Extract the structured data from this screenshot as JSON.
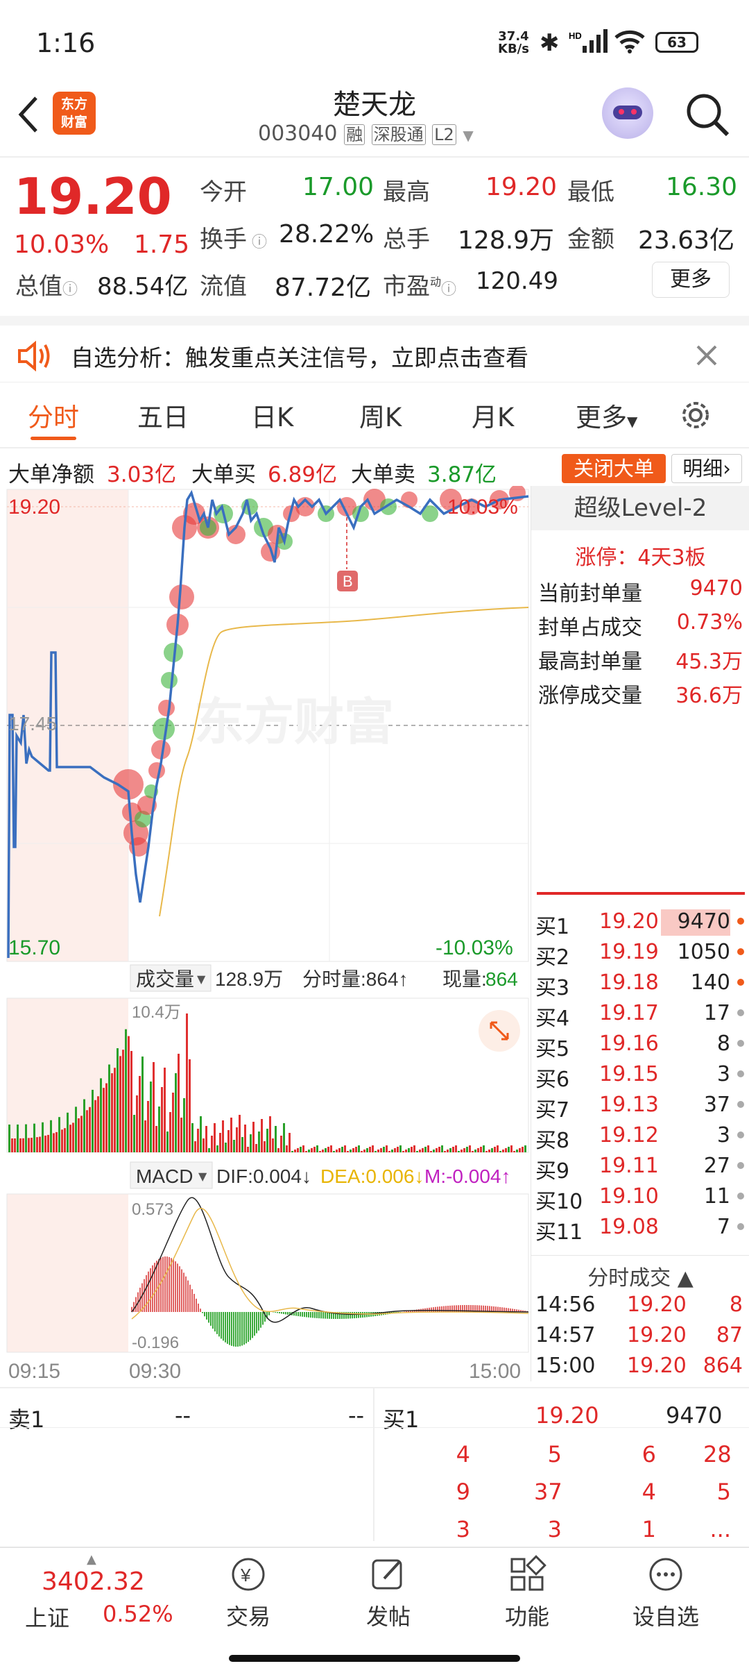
{
  "status": {
    "time": "1:16",
    "speed_top": "37.4",
    "speed_bottom": "KB/s",
    "battery": "63"
  },
  "header": {
    "app_logo_line1": "东方",
    "app_logo_line2": "财富",
    "name": "楚天龙",
    "code": "003040",
    "tag1": "融",
    "tag2": "深股通",
    "tag3": "L2"
  },
  "quote": {
    "price": "19.20",
    "pct": "10.03%",
    "chg": "1.75",
    "open_label": "今开",
    "open": "17.00",
    "high_label": "最高",
    "high": "19.20",
    "low_label": "最低",
    "low": "16.30",
    "turnover_label": "换手",
    "turnover": "28.22%",
    "vol_label": "总手",
    "vol": "128.9万",
    "amount_label": "金额",
    "amount": "23.63亿",
    "mcap_label": "总值",
    "mcap": "88.54亿",
    "float_label": "流值",
    "float": "87.72亿",
    "pe_label": "市盈",
    "pe_sup": "动",
    "pe": "120.49",
    "more": "更多"
  },
  "banner": {
    "text": "自选分析：触发重点关注信号，立即点击查看"
  },
  "tabs": [
    "分时",
    "五日",
    "日K",
    "周K",
    "月K",
    "更多"
  ],
  "bigorder": {
    "net_label": "大单净额",
    "net": "3.03亿",
    "buy_label": "大单买",
    "buy": "6.89亿",
    "sell_label": "大单卖",
    "sell": "3.87亿",
    "close_btn": "关闭大单",
    "detail_btn": "明细"
  },
  "chart": {
    "top_price": "19.20",
    "top_pct": "10.03%",
    "mid_price": "17.45",
    "bottom_price": "15.70",
    "bottom_pct": "-10.03%",
    "watermark": "东方财富",
    "marker": "B",
    "vol_label": "成交量",
    "vol_total": "128.9万",
    "vol_min_label": "分时量:864↑",
    "vol_now_label": "现量:",
    "vol_now": "864",
    "vol_max": "10.4万",
    "macd_label": "MACD",
    "dif": "DIF:0.004↓",
    "dea": "DEA:0.006↓",
    "m": "M:-0.004↑",
    "macd_max": "0.573",
    "macd_min": "-0.196",
    "t_start": "09:15",
    "t_open": "09:30",
    "t_end": "15:00"
  },
  "level2": {
    "title": "超级Level-2",
    "limit": "涨停：4天3板",
    "rows": [
      {
        "label": "当前封单量",
        "value": "9470"
      },
      {
        "label": "封单占成交",
        "value": "0.73%"
      },
      {
        "label": "最高封单量",
        "value": "45.3万"
      },
      {
        "label": "涨停成交量",
        "value": "36.6万"
      }
    ]
  },
  "bids": [
    {
      "l": "买1",
      "p": "19.20",
      "v": "9470"
    },
    {
      "l": "买2",
      "p": "19.19",
      "v": "1050"
    },
    {
      "l": "买3",
      "p": "19.18",
      "v": "140"
    },
    {
      "l": "买4",
      "p": "19.17",
      "v": "17"
    },
    {
      "l": "买5",
      "p": "19.16",
      "v": "8"
    },
    {
      "l": "买6",
      "p": "19.15",
      "v": "3"
    },
    {
      "l": "买7",
      "p": "19.13",
      "v": "37"
    },
    {
      "l": "买8",
      "p": "19.12",
      "v": "3"
    },
    {
      "l": "买9",
      "p": "19.11",
      "v": "27"
    },
    {
      "l": "买10",
      "p": "19.10",
      "v": "11"
    },
    {
      "l": "买11",
      "p": "19.08",
      "v": "7"
    }
  ],
  "ticks": {
    "title": "分时成交",
    "rows": [
      {
        "t": "14:56",
        "p": "19.20",
        "v": "8"
      },
      {
        "t": "14:57",
        "p": "19.20",
        "v": "87"
      },
      {
        "t": "15:00",
        "p": "19.20",
        "v": "864"
      }
    ]
  },
  "orders": {
    "sell_label": "卖1",
    "sell_p": "--",
    "sell_v": "--",
    "buy_label": "买1",
    "buy_p": "19.20",
    "buy_v": "9470",
    "grid": [
      [
        "4",
        "5",
        "6",
        "28"
      ],
      [
        "9",
        "37",
        "4",
        "5"
      ],
      [
        "3",
        "3",
        "1",
        "..."
      ]
    ]
  },
  "index": {
    "value": "3402.32",
    "name": "上证",
    "pct": "0.52%"
  },
  "nav": [
    "交易",
    "发帖",
    "功能",
    "设自选"
  ]
}
